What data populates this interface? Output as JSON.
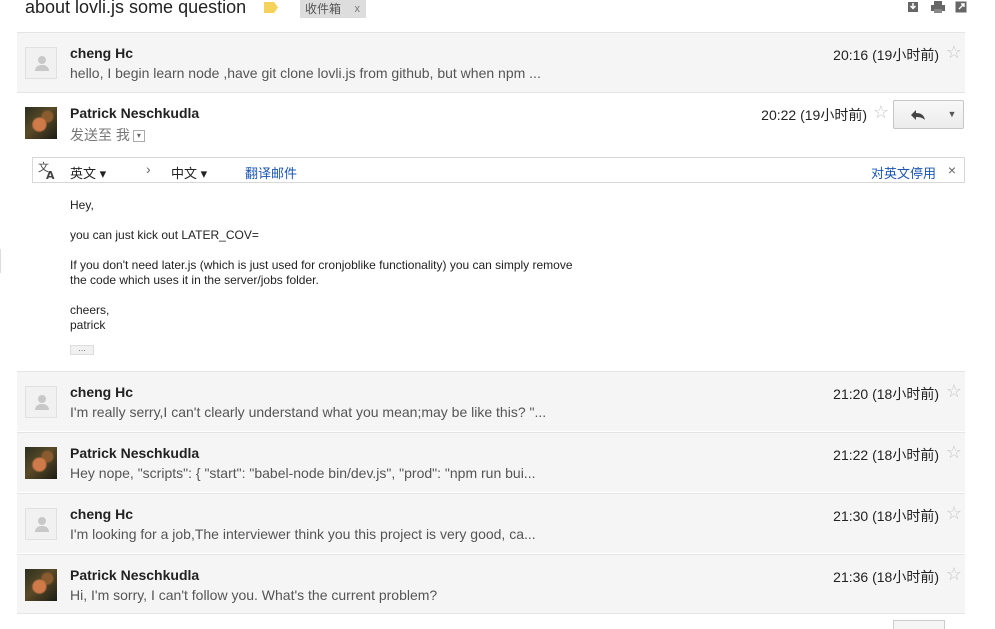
{
  "header": {
    "subject": "about lovli.js some question",
    "label_tag_color": "#f5d35a",
    "inbox_label": "收件箱",
    "inbox_remove": "x",
    "icons": [
      "download-icon",
      "print-icon",
      "new-window-icon"
    ]
  },
  "thread": [
    {
      "sender": "cheng Hc",
      "avatar": "default",
      "time": "20:16 (19小时前)",
      "snippet": "hello, I begin learn node ,have git clone lovli.js from github, but when npm ..."
    },
    {
      "sender": "Patrick Neschkudla",
      "avatar": "photo",
      "time": "20:22 (19小时前)",
      "sent_to": "发送至 我",
      "expanded": true
    },
    {
      "sender": "cheng Hc",
      "avatar": "default",
      "time": "21:20 (18小时前)",
      "snippet": "I'm really serry,I can't clearly understand what you mean;may be like this? \"..."
    },
    {
      "sender": "Patrick Neschkudla",
      "avatar": "photo",
      "time": "21:22 (18小时前)",
      "snippet": "Hey nope, \"scripts\": { \"start\": \"babel-node bin/dev.js\", \"prod\": \"npm run bui..."
    },
    {
      "sender": "cheng Hc",
      "avatar": "default",
      "time": "21:30 (18小时前)",
      "snippet": "I'm looking for a job,The interviewer think you this project is very good, ca..."
    },
    {
      "sender": "Patrick Neschkudla",
      "avatar": "photo",
      "time": "21:36 (18小时前)",
      "snippet": "Hi, I'm sorry, I can't follow you. What's the current problem?"
    }
  ],
  "translate": {
    "source_lang": "英文",
    "target_lang": "中文",
    "translate_link": "翻译邮件",
    "stop_link": "对英文停用",
    "close": "×"
  },
  "body": {
    "greeting": "Hey,",
    "line1": "you can just kick out LATER_COV=",
    "line2a": "If you don't need later.js (which is just used for cronjoblike functionality) you can simply remove",
    "line2b": "the code which uses it in the server/jobs folder.",
    "closing1": "cheers,",
    "closing2": "patrick",
    "ellipsis": "..."
  }
}
